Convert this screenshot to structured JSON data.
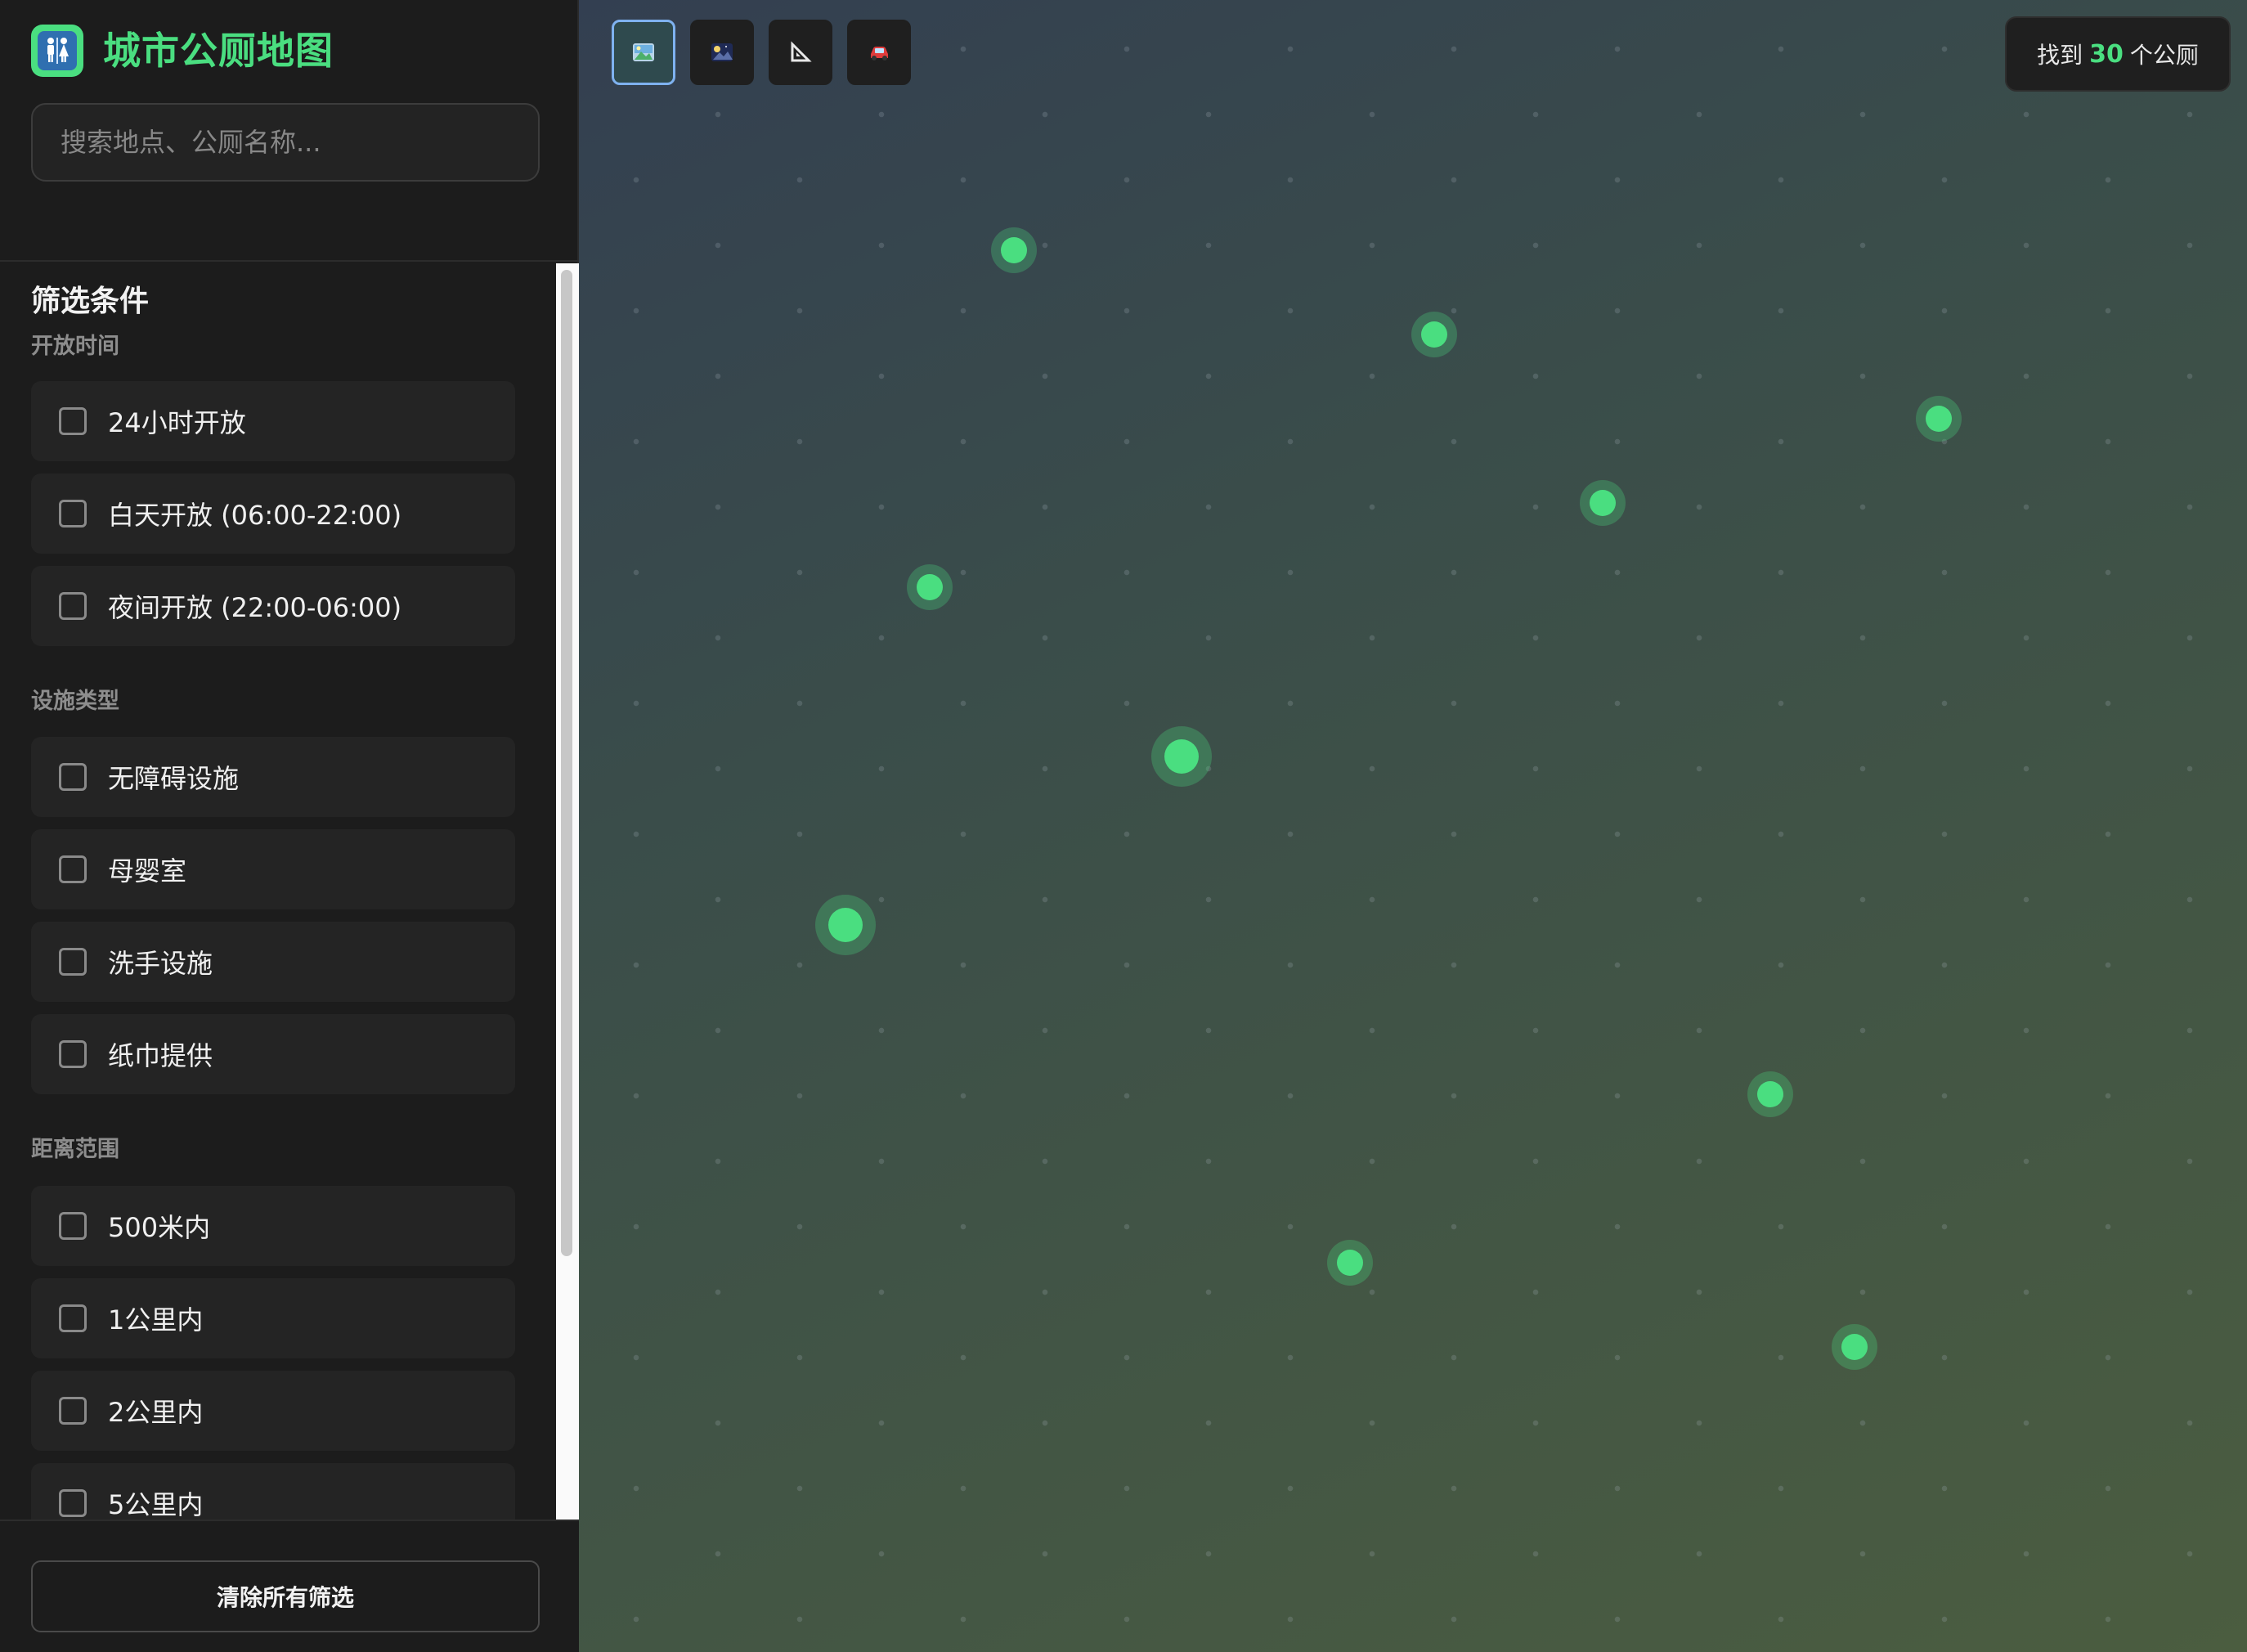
{
  "app": {
    "title": "城市公厕地图",
    "brand_color": "#4ade80"
  },
  "search": {
    "placeholder": "搜索地点、公厕名称...",
    "value": ""
  },
  "filters": {
    "title": "筛选条件",
    "groups": [
      {
        "label": "开放时间",
        "options": [
          {
            "label": "24小时开放",
            "checked": false
          },
          {
            "label": "白天开放 (06:00-22:00)",
            "checked": false
          },
          {
            "label": "夜间开放 (22:00-06:00)",
            "checked": false
          }
        ]
      },
      {
        "label": "设施类型",
        "options": [
          {
            "label": "无障碍设施",
            "checked": false
          },
          {
            "label": "母婴室",
            "checked": false
          },
          {
            "label": "洗手设施",
            "checked": false
          },
          {
            "label": "纸巾提供",
            "checked": false
          }
        ]
      },
      {
        "label": "距离范围",
        "options": [
          {
            "label": "500米内",
            "checked": false
          },
          {
            "label": "1公里内",
            "checked": false
          },
          {
            "label": "2公里内",
            "checked": false
          },
          {
            "label": "5公里内",
            "checked": false
          }
        ]
      }
    ]
  },
  "footer": {
    "clear_label": "清除所有筛选"
  },
  "map": {
    "tools": [
      {
        "name": "map-view-icon",
        "active": true
      },
      {
        "name": "night-view-icon",
        "active": false
      },
      {
        "name": "measure-icon",
        "active": false
      },
      {
        "name": "car-icon",
        "active": false
      }
    ],
    "result": {
      "prefix": "找到",
      "count": "30",
      "suffix": "个公厕"
    },
    "marker_color": "#4ade80"
  }
}
